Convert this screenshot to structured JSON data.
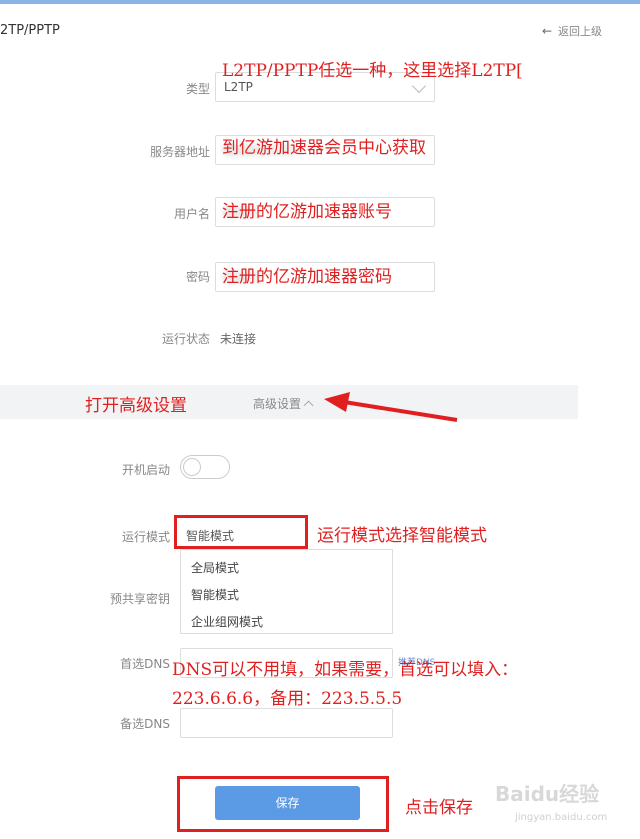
{
  "header": {
    "title": "2TP/PPTP",
    "back_label": "返回上级"
  },
  "form": {
    "type_label": "类型",
    "type_value": "L2TP",
    "server_label": "服务器地址",
    "username_label": "用户名",
    "password_label": "密码",
    "status_label": "运行状态",
    "status_value": "未连接",
    "advanced_label": "高级设置",
    "autostart_label": "开机启动",
    "mode_label": "运行模式",
    "mode_value": "智能模式",
    "mode_options": [
      "全局模式",
      "智能模式",
      "企业组网模式"
    ],
    "psk_label": "预共享密钥",
    "dns1_label": "首选DNS",
    "dns2_label": "备选DNS",
    "dns_hint": "推荐DNS",
    "save_label": "保存"
  },
  "annotations": {
    "type_note": "L2TP/PPTP任选一种，这里选择L2TP[",
    "server_note": "到亿游加速器会员中心获取",
    "username_note": "注册的亿游加速器账号",
    "password_note": "注册的亿游加速器密码",
    "advanced_note": "打开高级设置",
    "mode_note": "运行模式选择智能模式",
    "dns_note_line1": "DNS可以不用填，如果需要，首选可以填入：",
    "dns_note_line2": "223.6.6.6，备用：223.5.5.5",
    "save_note": "点击保存"
  },
  "watermark": {
    "brand": "Baidu经验",
    "url": "jingyan.baidu.com"
  },
  "colors": {
    "annotation": "#e02020",
    "button": "#5b9be6",
    "band": "#f2f3f5"
  }
}
